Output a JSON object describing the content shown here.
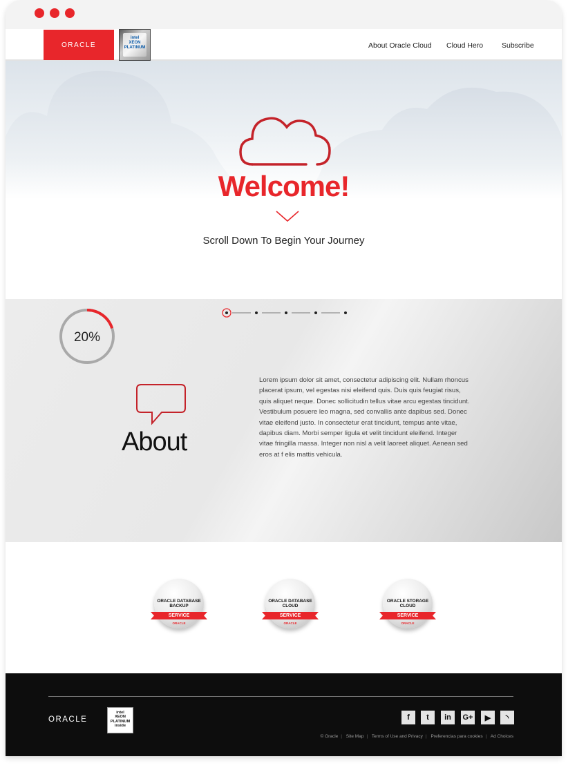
{
  "nav": {
    "oracle_logo": "ORACLE",
    "intel_badge": "intel XEON PLATINUM",
    "links": [
      "About Oracle Cloud",
      "Cloud Hero",
      "Subscribe"
    ]
  },
  "hero": {
    "title": "Welcome!",
    "subtitle": "Scroll Down To Begin Your Journey"
  },
  "about": {
    "progress_label": "20%",
    "progress_value": 0.2,
    "steps_total": 5,
    "steps_active": 1,
    "title": "About",
    "body": "Lorem ipsum dolor sit amet, consectetur adipiscing elit. Nullam rhoncus placerat ipsum, vel egestas nisi eleifend quis. Duis quis feugiat risus, quis aliquet neque. Donec sollicitudin tellus vitae arcu egestas tincidunt. Vestibulum posuere leo magna, sed convallis ante dapibus sed. Donec vitae eleifend justo. In consectetur erat tincidunt, tempus ante vitae, dapibus diam. Morbi semper ligula et velit tincidunt eleifend. Integer vitae fringilla massa. Integer non nisl a velit laoreet aliquet. Aenean sed eros at f elis mattis vehicula."
  },
  "badges": [
    {
      "title": "ORACLE DATABASE BACKUP",
      "ribbon": "SERVICE",
      "brand": "ORACLE"
    },
    {
      "title": "ORACLE DATABASE CLOUD",
      "ribbon": "SERVICE",
      "brand": "ORACLE"
    },
    {
      "title": "ORACLE STORAGE CLOUD",
      "ribbon": "SERVICE",
      "brand": "ORACLE"
    }
  ],
  "footer": {
    "oracle_logo": "ORACLE",
    "intel_badge": "intel XEON PLATINUM inside",
    "social": [
      {
        "icon": "facebook-icon",
        "glyph": "f"
      },
      {
        "icon": "twitter-icon",
        "glyph": "t"
      },
      {
        "icon": "linkedin-icon",
        "glyph": "in"
      },
      {
        "icon": "google-plus-icon",
        "glyph": "G+"
      },
      {
        "icon": "youtube-icon",
        "glyph": "▶"
      },
      {
        "icon": "rss-icon",
        "glyph": "◝"
      }
    ],
    "links": [
      "© Oracle",
      "Site Map",
      "Terms of Use and Privacy",
      "Preferencias para cookies",
      "Ad Choices"
    ]
  },
  "colors": {
    "accent": "#e8262b",
    "footer_bg": "#0d0d0d",
    "hero_sky": "#dce3ea"
  }
}
